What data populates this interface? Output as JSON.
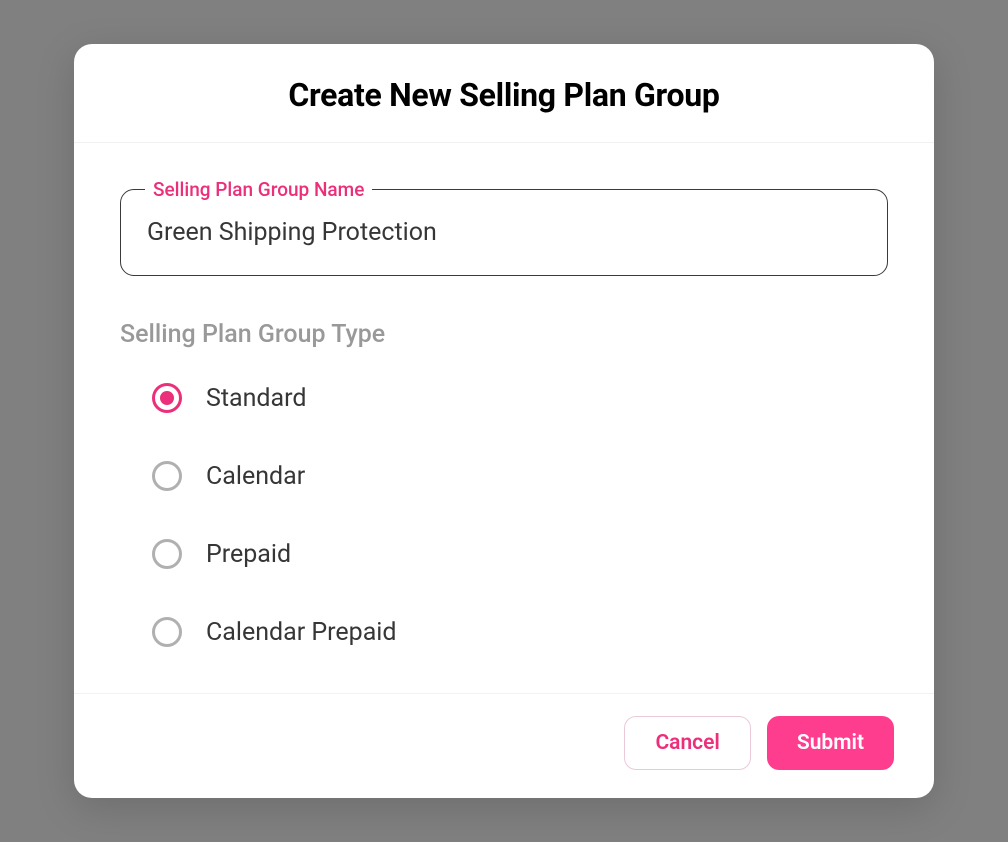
{
  "modal": {
    "title": "Create New Selling Plan Group",
    "nameField": {
      "label": "Selling Plan Group Name",
      "value": "Green Shipping Protection"
    },
    "typeSection": {
      "label": "Selling Plan Group Type",
      "options": [
        {
          "label": "Standard",
          "selected": true
        },
        {
          "label": "Calendar",
          "selected": false
        },
        {
          "label": "Prepaid",
          "selected": false
        },
        {
          "label": "Calendar Prepaid",
          "selected": false
        }
      ]
    },
    "actions": {
      "cancel": "Cancel",
      "submit": "Submit"
    }
  },
  "colors": {
    "accent": "#ec2f7b",
    "primary": "#ff3d8f"
  }
}
